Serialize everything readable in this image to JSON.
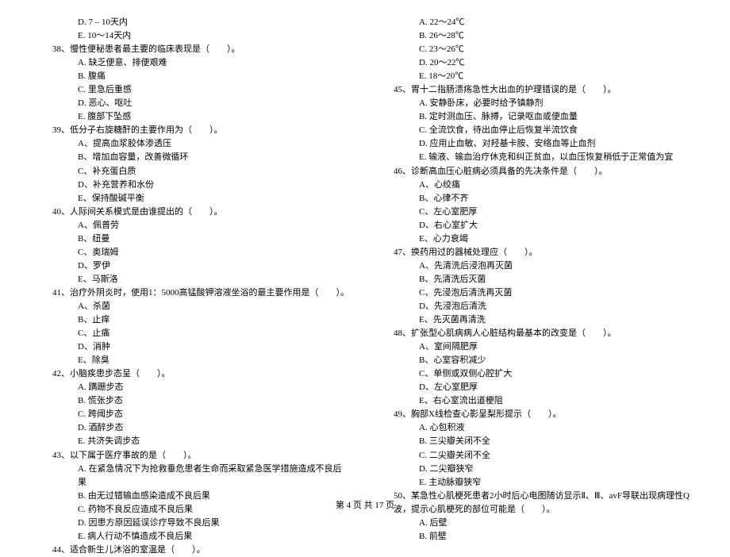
{
  "left": {
    "pre_options": [
      "D. 7 – 10天内",
      "E. 10～14天内"
    ],
    "questions": [
      {
        "num": "38、",
        "stem": "慢性便秘患者最主要的临床表现是（　　）。",
        "options": [
          "A. 缺乏便意、排便艰难",
          "B. 腹痛",
          "C. 里急后重感",
          "D. 恶心、呕吐",
          "E. 腹部下坠感"
        ]
      },
      {
        "num": "39、",
        "stem": "低分子右旋糖酐的主要作用为（　　）。",
        "options": [
          "A、提高血浆胶体渗透压",
          "B、增加血容量，改善微循环",
          "C、补充蛋白质",
          "D、补充营养和水份",
          "E、保持酸碱平衡"
        ]
      },
      {
        "num": "40、",
        "stem": "人际间关系模式是由谁提出的（　　）。",
        "options": [
          "A、佩普劳",
          "B、纽曼",
          "C、奥瑞姆",
          "D、罗伊",
          "E、马斯洛"
        ]
      },
      {
        "num": "41、",
        "stem": "治疗外阴炎时，使用1：5000高锰酸钾溶液坐浴的最主要作用是（　　）。",
        "options": [
          "A、杀菌",
          "B、止痒",
          "C、止痛",
          "D、消肿",
          "E、除臭"
        ]
      },
      {
        "num": "42、",
        "stem": "小脑疾患步态呈（　　）。",
        "options": [
          "A. 蹒跚步态",
          "B. 慌张步态",
          "C. 跨阈步态",
          "D. 酒醉步态",
          "E. 共济失调步态"
        ]
      },
      {
        "num": "43、",
        "stem": "以下属于医疗事故的是（　　）。",
        "options": [
          "A. 在紧急情况下为抢救垂危患者生命而采取紧急医学措施造成不良后果",
          "B. 由无过错输血感染造成不良后果",
          "C. 药物不良反应造成不良后果",
          "D. 因患方原因延误诊疗导致不良后果",
          "E. 病人行动不慎造成不良后果"
        ]
      },
      {
        "num": "44、",
        "stem": "适合新生儿沐浴的室温是（　　）。",
        "options": []
      }
    ]
  },
  "right": {
    "pre_options": [
      "A. 22～24℃",
      "B. 26～28℃",
      "C. 23～26℃",
      "D. 20～22℃",
      "E. 18～20℃"
    ],
    "questions": [
      {
        "num": "45、",
        "stem": "胃十二指肠溃疡急性大出血的护理错误的是（　　）。",
        "options": [
          "A. 安静卧床，必要时给予镇静剂",
          "B. 定时测血压、脉搏，记录呕血或便血量",
          "C. 全流饮食，待出血停止后恢复半流饮食",
          "D. 应用止血敏、对羟基卡胺、安络血等止血剂",
          "E. 输液、输血治疗休克和纠正贫血，以血压恢复稍低于正常值为宜"
        ]
      },
      {
        "num": "46、",
        "stem": "诊断高血压心脏病必须具备的先决条件是（　　）。",
        "options": [
          "A、心绞痛",
          "B、心律不齐",
          "C、左心室肥厚",
          "D、右心室扩大",
          "E、心力衰竭"
        ]
      },
      {
        "num": "47、",
        "stem": "换药用过的器械处理应（　　）。",
        "options": [
          "A、先清洗后浸泡再灭菌",
          "B、先清洗后灭菌",
          "C、先浸泡后清洗再灭菌",
          "D、先浸泡后清洗",
          "E、先灭菌再清洗"
        ]
      },
      {
        "num": "48、",
        "stem": "扩张型心肌病病人心脏结构最基本的改变是（　　）。",
        "options": [
          "A、室间隔肥厚",
          "B、心室容积减少",
          "C、单侧或双侧心腔扩大",
          "D、左心室肥厚",
          "E、右心室流出道梗阻"
        ]
      },
      {
        "num": "49、",
        "stem": "胸部X线检查心影呈梨形提示（　　）。",
        "options": [
          "A. 心包积液",
          "B. 三尖瓣关闭不全",
          "C. 二尖瓣关闭不全",
          "D. 二尖瓣狭窄",
          "E. 主动脉瓣狭窄"
        ]
      },
      {
        "num": "50、",
        "stem": "某急性心肌梗死患者2小时后心电图随访显示Ⅱ、Ⅲ、avF导联出现病理性Q波，提示心肌梗死的部位可能是（　　）。",
        "options": [
          "A. 后壁",
          "B. 前壁"
        ]
      }
    ]
  },
  "footer": "第 4 页 共 17 页"
}
